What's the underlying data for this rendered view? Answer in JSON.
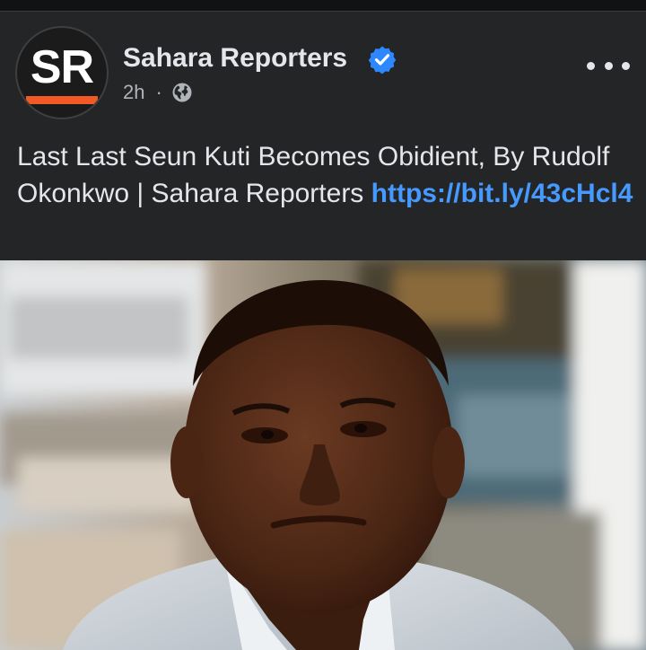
{
  "post": {
    "page_name": "Sahara Reporters",
    "avatar_text": "SR",
    "timestamp": "2h",
    "separator": "·",
    "audience_icon": "globe-icon",
    "verified_icon": "verified-badge-icon",
    "more_icon": "more-options-icon",
    "text": "Last Last Seun Kuti Becomes Obidient, By Rudolf Okonkwo | Sahara Reporters ",
    "link_text": "https://bit.ly/43cHcl4",
    "image_alt": "Photo of a man in a striped shirt"
  },
  "colors": {
    "background": "#242526",
    "text": "#e4e6eb",
    "secondary_text": "#b0b3b8",
    "link": "#4599ff",
    "verified": "#2d88ff",
    "brand_orange": "#f15a24"
  }
}
